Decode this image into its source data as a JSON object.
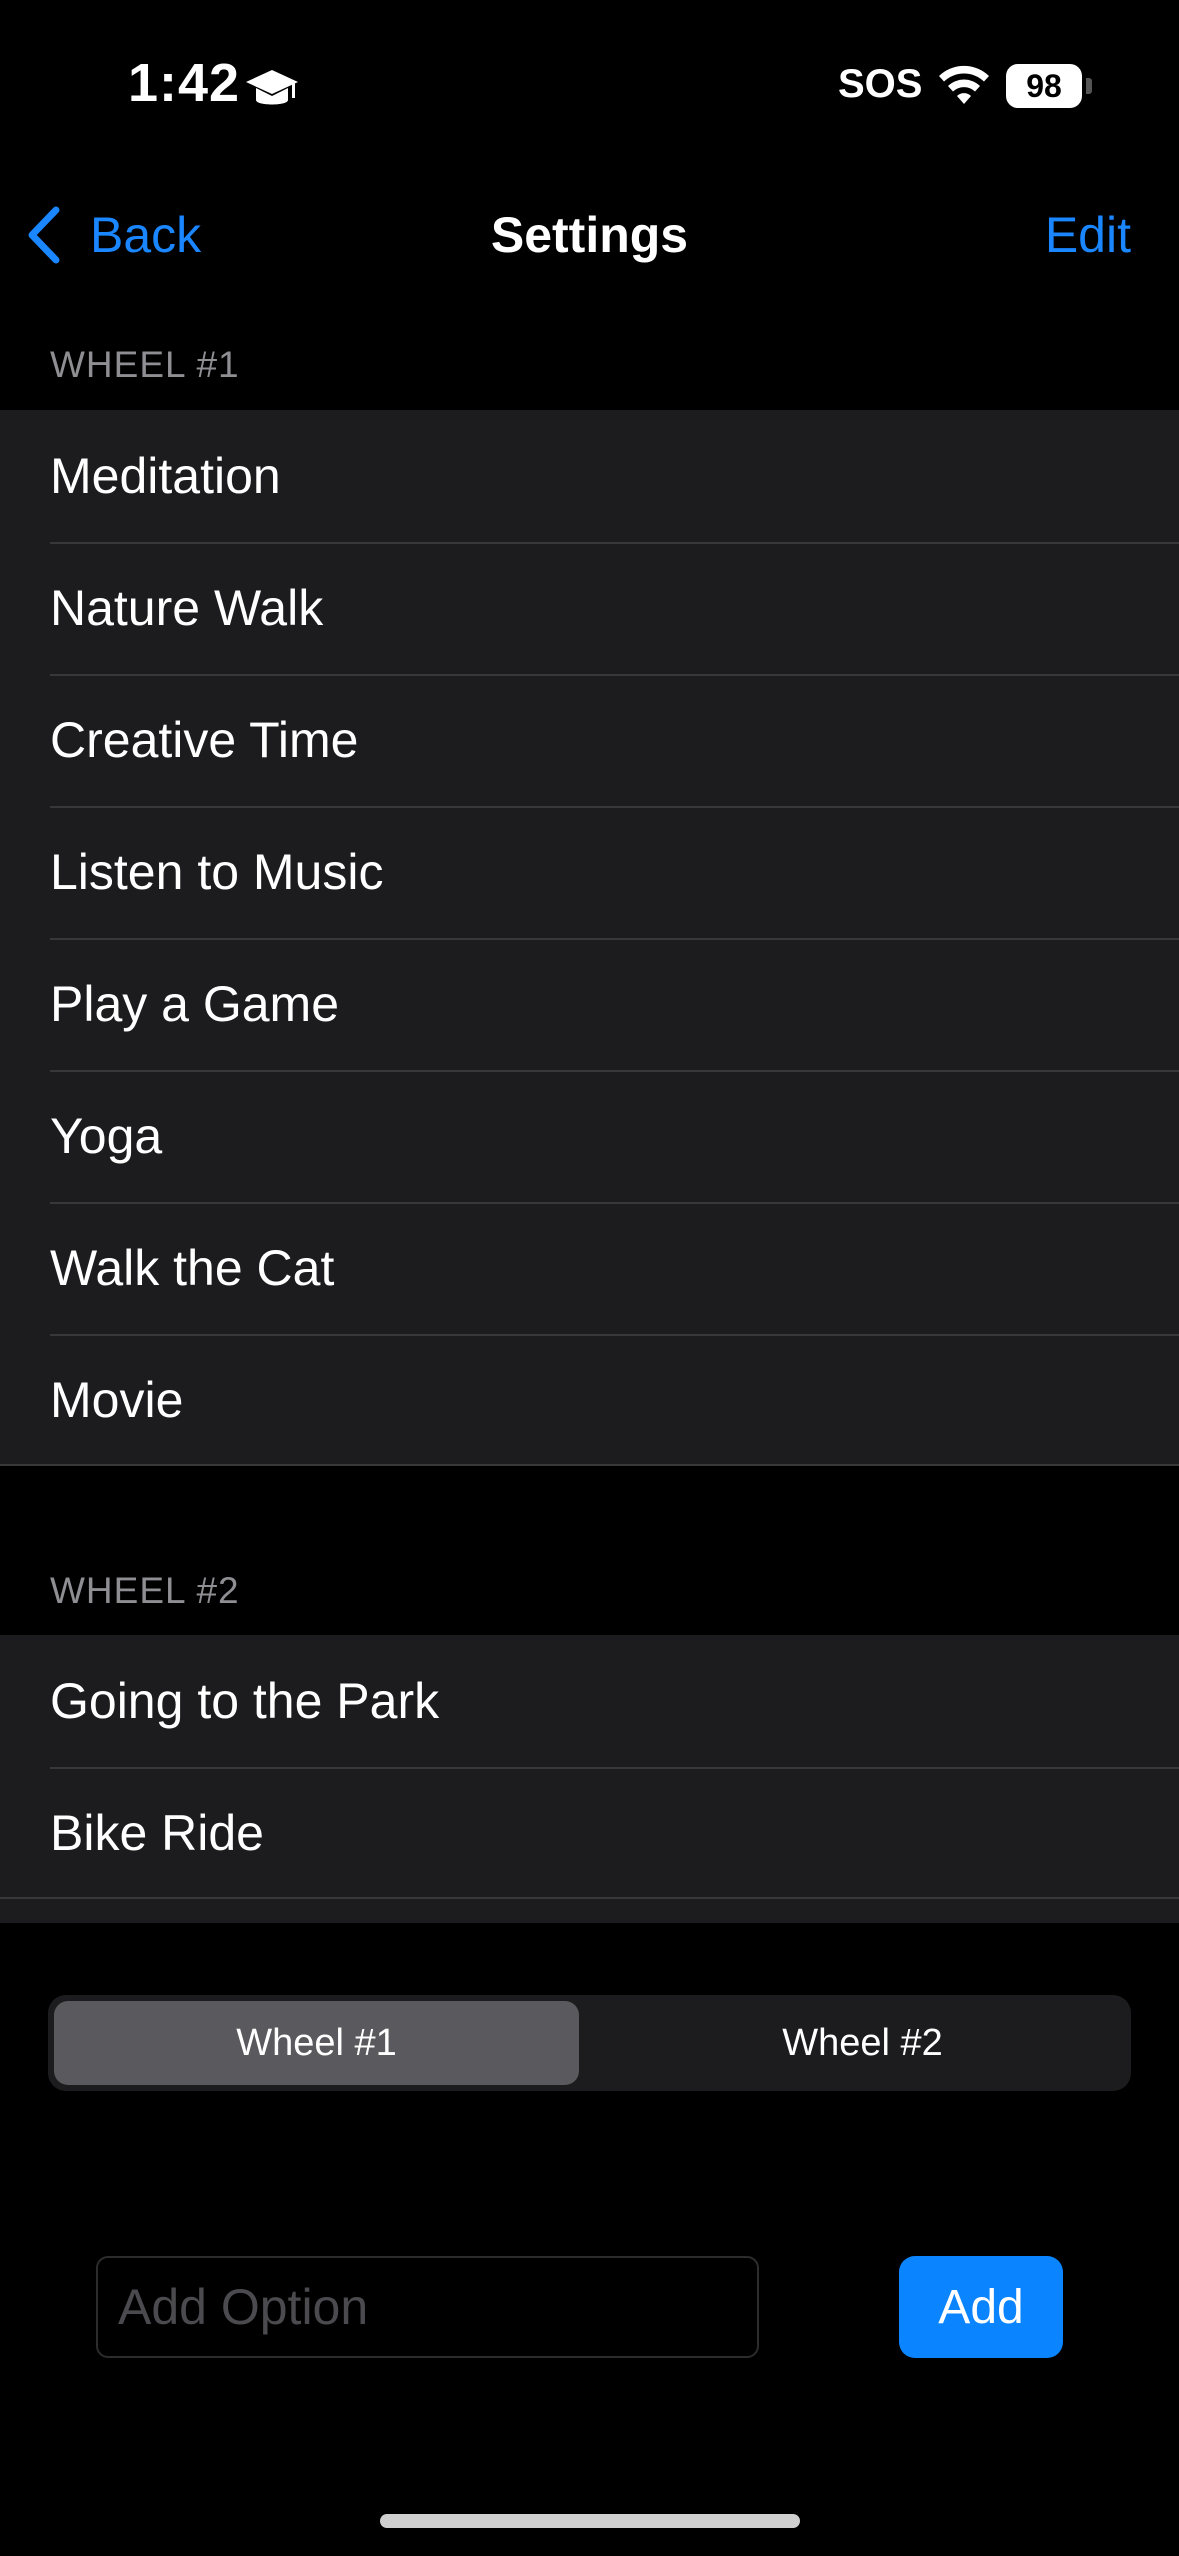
{
  "status_bar": {
    "time": "1:42",
    "carrier": "SOS",
    "battery": "98",
    "icons": [
      "graduation-cap-icon",
      "wifi-icon",
      "battery-icon"
    ]
  },
  "nav": {
    "back_label": "Back",
    "title": "Settings",
    "edit_label": "Edit"
  },
  "wheel1": {
    "header": "WHEEL #1",
    "items": [
      "Meditation",
      "Nature Walk",
      "Creative Time",
      "Listen to Music",
      "Play a Game",
      "Yoga",
      "Walk the Cat",
      "Movie"
    ]
  },
  "wheel2": {
    "header": "WHEEL #2",
    "items": [
      "Going to the Park",
      "Bike Ride"
    ]
  },
  "segmented": {
    "segments": [
      "Wheel #1",
      "Wheel #2"
    ],
    "selected": "Wheel #1"
  },
  "add_option": {
    "placeholder": "Add Option",
    "value": "",
    "button_label": "Add"
  },
  "colors": {
    "accent": "#0a84ff",
    "link": "#1a86ff",
    "background": "#000000",
    "cell": "#1c1c1e"
  }
}
